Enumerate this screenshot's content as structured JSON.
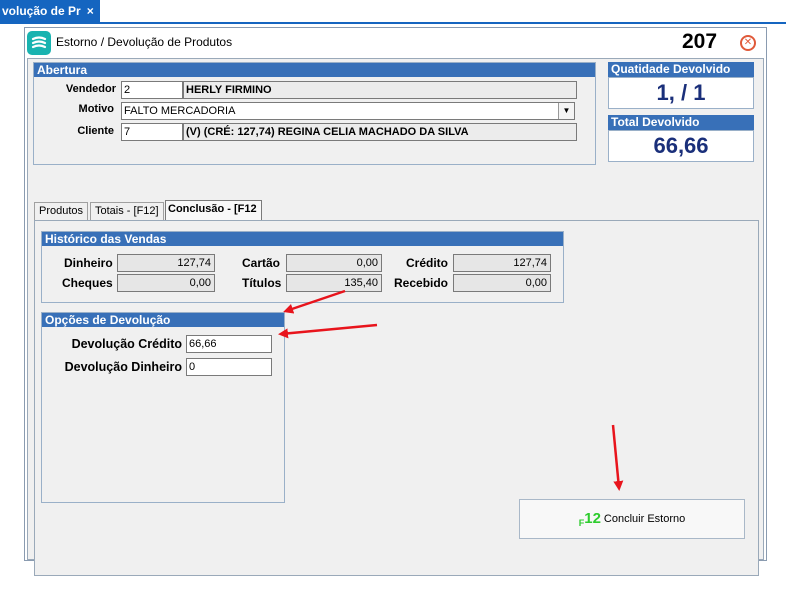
{
  "top_tab": {
    "label": "volução de Pr",
    "close": "×"
  },
  "window": {
    "title": "Estorno / Devolução de Produtos",
    "number": "207"
  },
  "abertura": {
    "header": "Abertura",
    "vendedor_label": "Vendedor",
    "vendedor_code": "2",
    "vendedor_name": "HERLY  FIRMINO",
    "motivo_label": "Motivo",
    "motivo_value": "FALTO MERCADORIA",
    "cliente_label": "Cliente",
    "cliente_code": "7",
    "cliente_name": "(V) (CRÉ: 127,74) REGINA CELIA MACHADO DA SILVA"
  },
  "summary": {
    "qty_label": "Quatidade Devolvido",
    "qty_value": "1, / 1",
    "total_label": "Total Devolvido",
    "total_value": "66,66"
  },
  "tabs": [
    {
      "label": "Produtos"
    },
    {
      "label": "Totais - [F12]"
    },
    {
      "label": "Conclusão - [F12"
    }
  ],
  "historico": {
    "header": "Histórico das Vendas",
    "dinheiro_label": "Dinheiro",
    "dinheiro_value": "127,74",
    "cartao_label": "Cartão",
    "cartao_value": "0,00",
    "credito_label": "Crédito",
    "credito_value": "127,74",
    "cheques_label": "Cheques",
    "cheques_value": "0,00",
    "titulos_label": "Títulos",
    "titulos_value": "135,40",
    "recebido_label": "Recebido",
    "recebido_value": "0,00"
  },
  "opcoes": {
    "header": "Opções de Devolução",
    "credito_label": "Devolução Crédito",
    "credito_value": "66,66",
    "dinheiro_label": "Devolução Dinheiro",
    "dinheiro_value": "0"
  },
  "conclude": {
    "key_main": "12",
    "key_prefix": "F",
    "label": "Concluir Estorno"
  },
  "colors": {
    "header_blue": "#3870b8",
    "tab_blue": "#1565c0",
    "value_navy": "#1a2f7a",
    "f12_green": "#2ecc2e",
    "arrow_red": "#e8141c"
  }
}
